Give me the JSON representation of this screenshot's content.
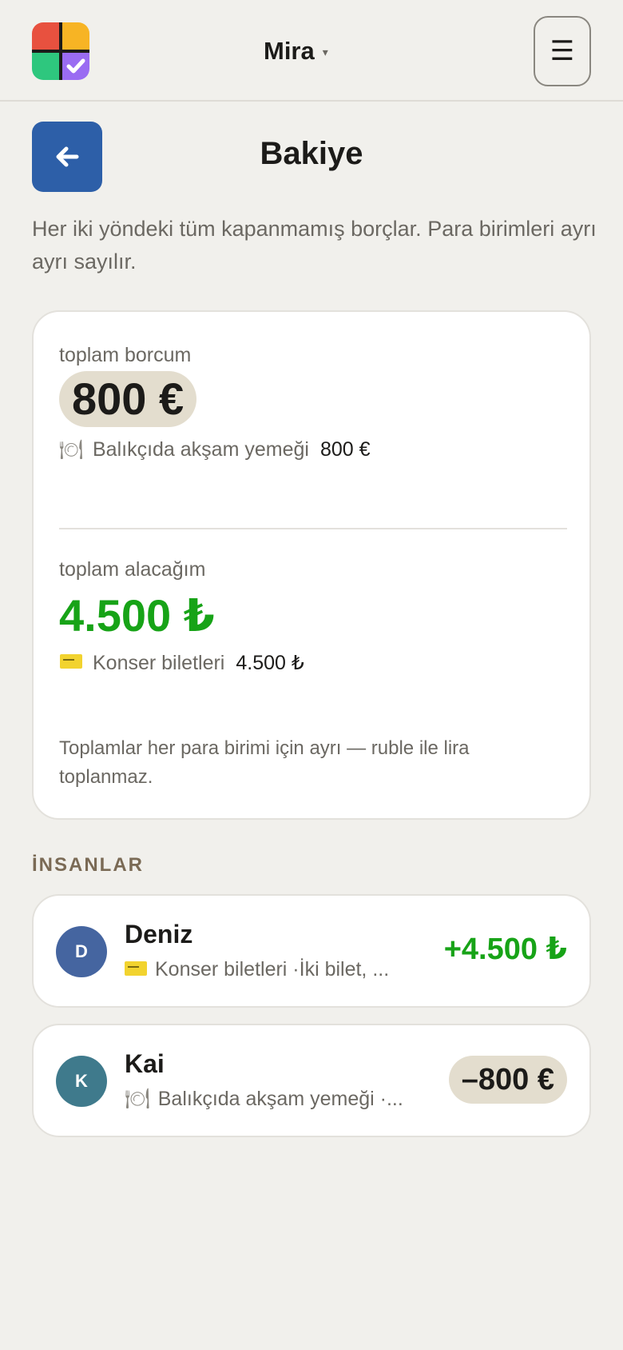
{
  "header": {
    "user_name": "Mira",
    "caret": "▾",
    "menu_icon": "☰"
  },
  "page": {
    "title": "Bakiye",
    "intro": "Her iki yöndeki tüm kapanmamış borçlar. Para birimleri ayrı ayrı sayılır."
  },
  "summary": {
    "owe_label": "toplam borcum",
    "owe_total": "800 €",
    "owe_item": {
      "icon": "🍽",
      "name": "Balıkçıda akşam yemeği",
      "amount": "800 €"
    },
    "receive_label": "toplam alacağım",
    "receive_total": "4.500 ₺",
    "receive_item": {
      "icon": "ticket-icon",
      "name": "Konser biletleri",
      "amount": "4.500 ₺"
    },
    "note": "Toplamlar her para birimi için ayrı — ruble ile lira toplanmaz."
  },
  "people_section": {
    "title": "İNSANLAR",
    "people": [
      {
        "initial": "D",
        "name": "Deniz",
        "icon": "ticket-icon",
        "subtitle": "Konser biletleri ·İki bilet, ...",
        "amount": "+4.500 ₺",
        "avatar_color": "#4565a0"
      },
      {
        "initial": "K",
        "name": "Kai",
        "icon": "🍽",
        "subtitle": "Balıkçıda akşam yemeği ·...",
        "amount": "–800 €",
        "avatar_color": "#3f7a8c"
      }
    ]
  },
  "colors": {
    "accent_blue": "#2d5fa8",
    "positive_green": "#17a317",
    "pill_bg": "#e3ddce",
    "background": "#f1f0ec"
  }
}
